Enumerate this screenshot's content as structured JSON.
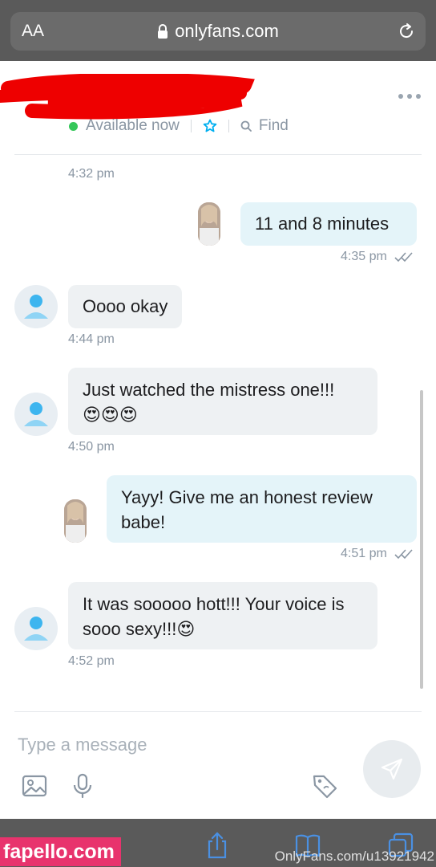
{
  "browser": {
    "text_size_label": "AA",
    "url": "onlyfans.com"
  },
  "chat": {
    "status_text": "Available now",
    "find_label": "Find"
  },
  "messages": [
    {
      "type": "time",
      "time": "4:32 pm"
    },
    {
      "type": "out",
      "text": "11 and 8 minutes",
      "time": "4:35 pm"
    },
    {
      "type": "in",
      "text": "Oooo okay",
      "time": "4:44 pm"
    },
    {
      "type": "in",
      "text": "Just watched the mistress one!!!",
      "emoji": "😍😍😍",
      "time": "4:50 pm"
    },
    {
      "type": "out",
      "text": "Yayy! Give me an honest review babe!",
      "time": "4:51 pm"
    },
    {
      "type": "in",
      "text": "It was sooooo hott!!! Your voice is sooo sexy!!!😍",
      "time": "4:52 pm"
    }
  ],
  "composer": {
    "placeholder": "Type a message"
  },
  "watermarks": {
    "left": "fapello.com",
    "right": "OnlyFans.com/u13921942"
  },
  "colors": {
    "accent": "#00aff0",
    "online": "#35c75a",
    "bubble_in": "#eef1f3",
    "bubble_out": "#e4f4f9",
    "redaction": "#ee0000"
  },
  "icons": [
    "lock-icon",
    "reload-icon",
    "more-icon",
    "star-icon",
    "search-icon",
    "double-check-icon",
    "image-icon",
    "mic-icon",
    "price-tag-icon",
    "send-icon",
    "share-icon",
    "bookmarks-icon",
    "tabs-icon"
  ]
}
